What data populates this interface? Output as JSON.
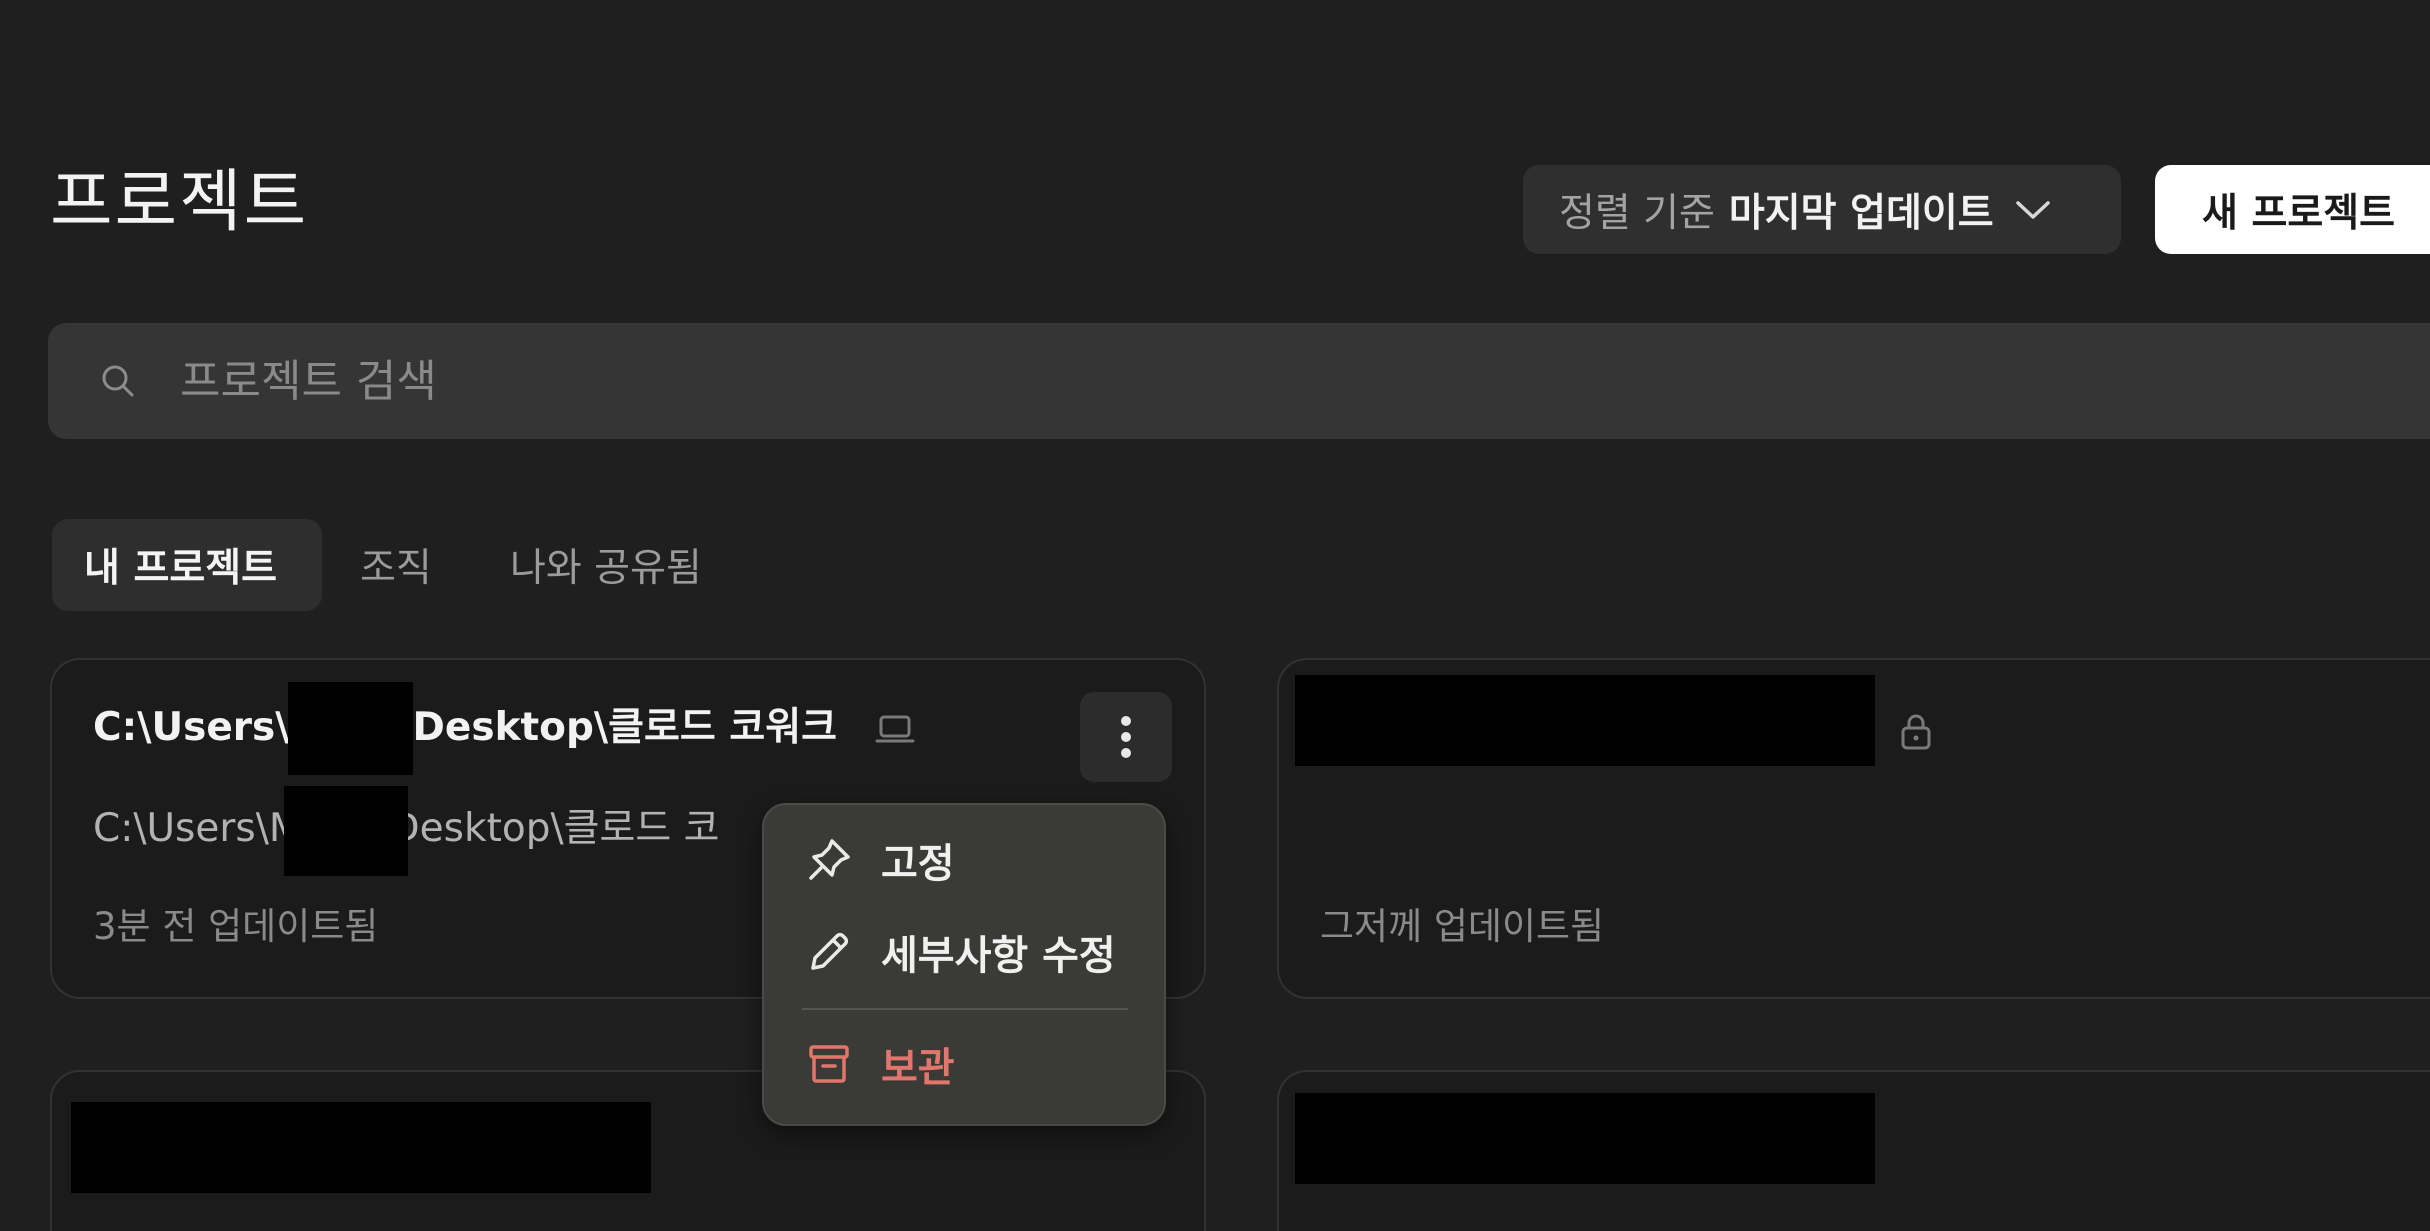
{
  "header": {
    "title": "프로젝트",
    "sort": {
      "prefix": "정렬 기준",
      "value": "마지막 업데이트",
      "icon": "chevron-down-icon"
    },
    "new_project_label": "새 프로젝트"
  },
  "search": {
    "placeholder": "프로젝트 검색",
    "value": "",
    "icon": "search-icon"
  },
  "tabs": [
    {
      "label": "내 프로젝트",
      "selected": true
    },
    {
      "label": "조직",
      "selected": false
    },
    {
      "label": "나와 공유됨",
      "selected": false
    }
  ],
  "cards": [
    {
      "title_prefix": "C:\\Users\\M",
      "title_suffix": "\\Desktop\\클로드 코워크",
      "subtitle_prefix": "C:\\Users\\M",
      "subtitle_suffix": "\\Desktop\\클로드 코",
      "updated": "3분 전 업데이트됨",
      "icon": "laptop-icon"
    },
    {
      "updated": "그저께 업데이트됨",
      "icon": "lock-icon"
    }
  ],
  "context_menu": {
    "items": [
      {
        "label": "고정",
        "icon": "pin-icon"
      },
      {
        "label": "세부사항 수정",
        "icon": "pencil-icon"
      },
      {
        "label": "보관",
        "icon": "archive-icon",
        "color": "#e2766c"
      }
    ]
  },
  "colors": {
    "background": "#1f1f1f",
    "card_background": "#1b1b1b",
    "danger": "#e2766c",
    "primary_button": "#ffffff"
  }
}
